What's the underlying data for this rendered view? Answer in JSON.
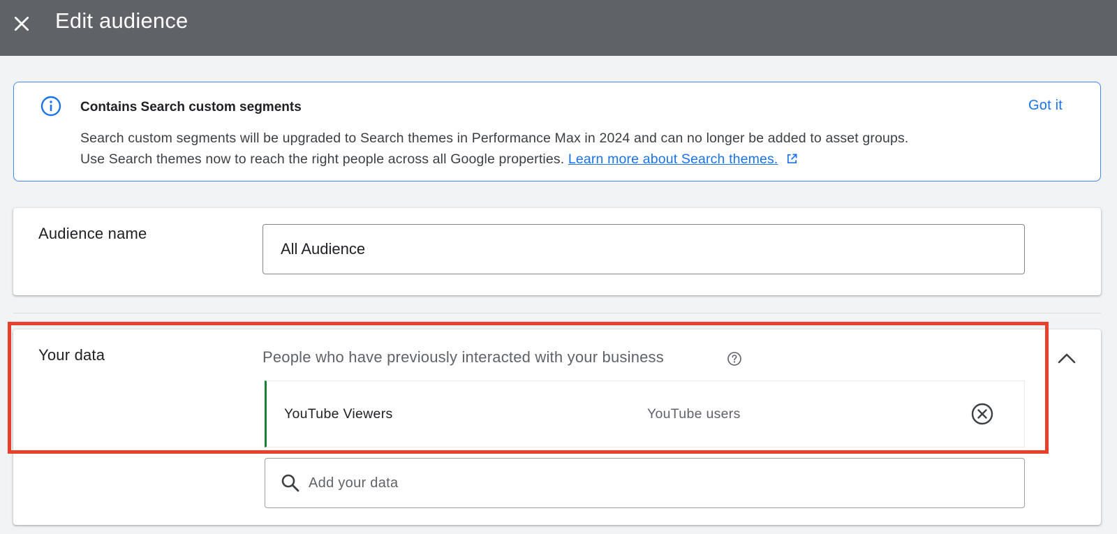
{
  "header": {
    "title": "Edit audience",
    "close_icon": "close-icon",
    "background": "#5f6368"
  },
  "banner": {
    "icon": "info-icon",
    "title": "Contains Search custom segments",
    "line1": "Search custom segments will be upgraded to Search themes in Performance Max in 2024 and can no longer be added to asset groups.",
    "line2": "Use Search themes now to reach the right people across all Google properties.",
    "link_label": "Learn more about Search themes.",
    "dismiss_label": "Got it",
    "accent": "#1a73e8"
  },
  "audience_name": {
    "label": "Audience name",
    "value": "All Audience"
  },
  "your_data": {
    "label": "Your data",
    "heading": "People who have previously interacted with your business",
    "items": [
      {
        "name": "YouTube Viewers",
        "type": "YouTube users"
      }
    ],
    "search_placeholder": "Add your data"
  },
  "highlight_color": "#e8402a"
}
